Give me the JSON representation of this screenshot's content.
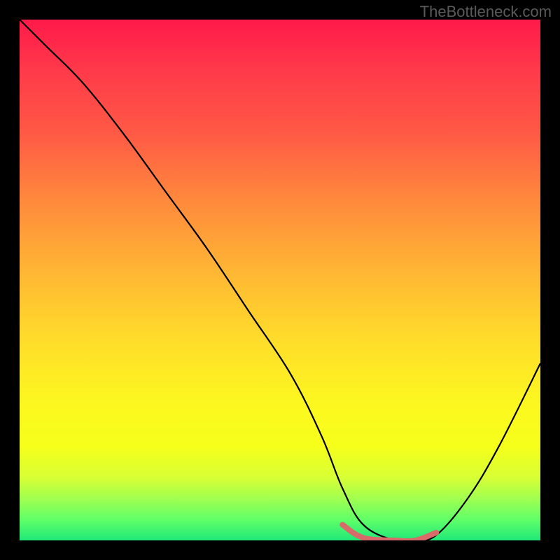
{
  "watermark": "TheBottleneck.com",
  "chart_data": {
    "type": "line",
    "title": "",
    "xlabel": "",
    "ylabel": "",
    "xlim": [
      0,
      100
    ],
    "ylim": [
      0,
      100
    ],
    "series": [
      {
        "name": "bottleneck-curve",
        "x": [
          0,
          5,
          12,
          20,
          28,
          36,
          44,
          52,
          58,
          62,
          66,
          72,
          76,
          80,
          86,
          92,
          100
        ],
        "y": [
          100,
          95,
          88,
          78,
          67,
          56,
          44,
          32,
          20,
          10,
          3,
          0,
          0,
          1,
          8,
          18,
          34
        ],
        "color": "#000000"
      },
      {
        "name": "highlight-segment",
        "x": [
          62,
          66,
          72,
          76,
          80
        ],
        "y": [
          3,
          0.5,
          0,
          0,
          1.5
        ],
        "color": "#d86a6a"
      }
    ],
    "gradient_stops": [
      {
        "offset": 0,
        "color": "#ff1a4a"
      },
      {
        "offset": 35,
        "color": "#ff8a3c"
      },
      {
        "offset": 62,
        "color": "#ffde2a"
      },
      {
        "offset": 82,
        "color": "#f6ff1a"
      },
      {
        "offset": 100,
        "color": "#20e878"
      }
    ]
  }
}
